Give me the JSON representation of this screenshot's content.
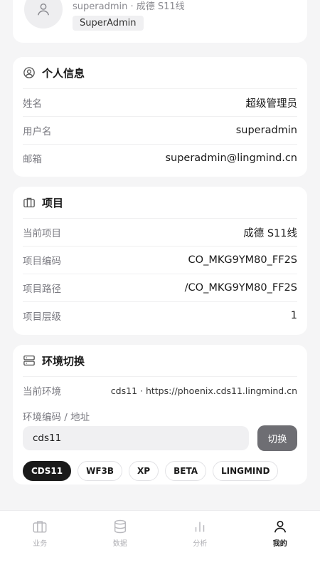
{
  "profile": {
    "sub_line": "superadmin · 成德 S11线",
    "role": "SuperAdmin"
  },
  "personal": {
    "title": "个人信息",
    "rows": [
      {
        "label": "姓名",
        "value": "超级管理员"
      },
      {
        "label": "用户名",
        "value": "superadmin"
      },
      {
        "label": "邮箱",
        "value": "superadmin@lingmind.cn"
      }
    ]
  },
  "project": {
    "title": "项目",
    "rows": [
      {
        "label": "当前项目",
        "value": "成德 S11线"
      },
      {
        "label": "项目编码",
        "value": "CO_MKG9YM80_FF2S"
      },
      {
        "label": "项目路径",
        "value": "/CO_MKG9YM80_FF2S"
      },
      {
        "label": "项目层级",
        "value": "1"
      }
    ]
  },
  "env": {
    "title": "环境切换",
    "current_label": "当前环境",
    "current_value": "cds11 · https://phoenix.cds11.lingmind.cn",
    "code_label": "环境编码 / 地址",
    "input_value": "cds11",
    "switch_label": "切换",
    "chips": [
      "CDS11",
      "WF3B",
      "XP",
      "BETA",
      "LINGMIND"
    ],
    "active_chip": "CDS11"
  },
  "nav": {
    "items": [
      {
        "label": "业务",
        "icon": "briefcase-icon"
      },
      {
        "label": "数据",
        "icon": "database-icon"
      },
      {
        "label": "分析",
        "icon": "bar-chart-icon"
      },
      {
        "label": "我的",
        "icon": "user-icon"
      }
    ],
    "active": "我的"
  },
  "colors": {
    "background": "#f5f5f6",
    "card": "#ffffff",
    "accent_dark": "#1a1a1a",
    "button_gray": "#6e6e73",
    "muted": "#7b7b82"
  }
}
